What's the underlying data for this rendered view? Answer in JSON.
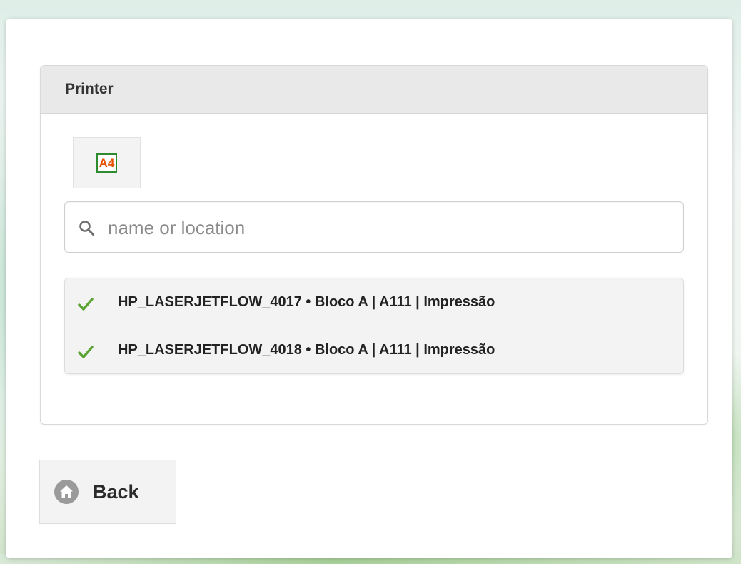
{
  "panel": {
    "title": "Printer"
  },
  "paper": {
    "label": "A4",
    "icon": "paper-size-a4-icon",
    "border_color": "#2d8a2d",
    "text_color": "#e65100"
  },
  "search": {
    "placeholder": "name or location",
    "value": "",
    "icon": "search-icon"
  },
  "printers": [
    {
      "label": "HP_LASERJETFLOW_4017 • Bloco A | A111 | Impressão",
      "status_icon": "check-icon"
    },
    {
      "label": "HP_LASERJETFLOW_4018 • Bloco A | A111 | Impressão",
      "status_icon": "check-icon"
    }
  ],
  "back_button": {
    "label": "Back",
    "icon": "home-icon"
  },
  "colors": {
    "check": "#5aa332",
    "header_bg": "#e9e9e9",
    "button_bg": "#f3f3f3"
  }
}
